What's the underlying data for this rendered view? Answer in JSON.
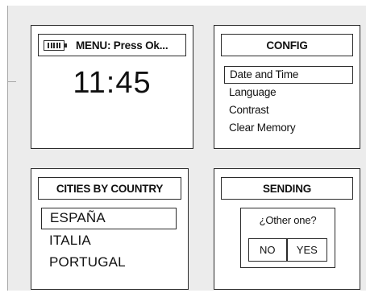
{
  "screens": {
    "menu": {
      "title": "MENU: Press Ok...",
      "time": "11:45",
      "icon": "battery-icon"
    },
    "config": {
      "title": "CONFIG",
      "items": [
        "Date and Time",
        "Language",
        "Contrast",
        "Clear Memory"
      ],
      "selected_index": 0
    },
    "cities": {
      "title": "CITIES BY COUNTRY",
      "items": [
        "ESPAÑA",
        "ITALIA",
        "PORTUGAL"
      ],
      "selected_index": 0
    },
    "sending": {
      "title": "SENDING",
      "question": "¿Other one?",
      "no_label": "NO",
      "yes_label": "YES"
    }
  },
  "colors": {
    "ink": "#2b2b2b",
    "sheet": "#ececec",
    "screen": "#ffffff"
  }
}
